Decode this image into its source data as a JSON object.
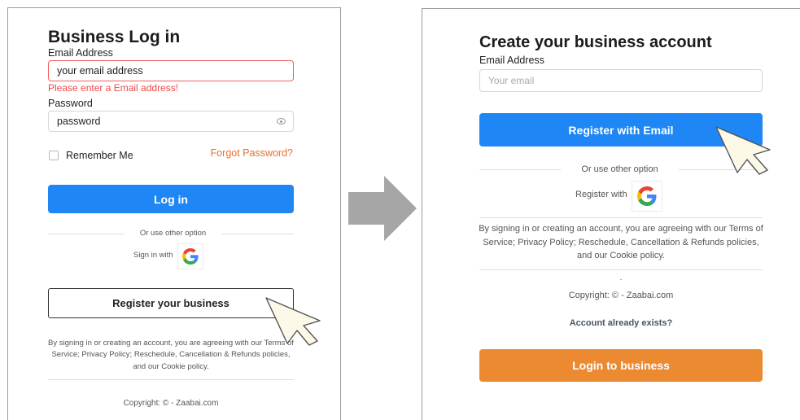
{
  "login": {
    "title": "Business Log in",
    "email_label": "Email Address",
    "email_value": "your email address",
    "email_error": "Please enter a Email address!",
    "password_label": "Password",
    "password_value": "password",
    "remember_label": "Remember Me",
    "forgot_label": "Forgot Password?",
    "login_button": "Log in",
    "divider_text": "Or use other option",
    "social_label": "Sign in with",
    "register_button": "Register your business",
    "legal_lines": [
      "By signing in or creating an account, you are agreeing with our Terms of",
      "Service; Privacy Policy; Reschedule, Cancellation & Refunds policies,",
      "and our Cookie policy."
    ],
    "copyright": "Copyright: © - Zaabai.com"
  },
  "register": {
    "title": "Create your business account",
    "email_label": "Email Address",
    "email_placeholder": "Your email",
    "register_button": "Register with Email",
    "divider_text": "Or use other option",
    "social_label": "Register with",
    "legal_lines": [
      "By signing in or creating an account, you are agreeing with our Terms of",
      "Service; Privacy Policy; Reschedule, Cancellation & Refunds policies,",
      "and our Cookie policy."
    ],
    "dot": ".",
    "copyright": "Copyright: © - Zaabai.com",
    "account_exists": "Account already exists?",
    "login_button": "Login to business"
  },
  "icons": {
    "arrow": "arrow-right-icon",
    "cursor": "pointer-cursor-icon",
    "google": "google-icon",
    "eye": "eye-icon"
  },
  "colors": {
    "primary_blue": "#1e87f5",
    "orange": "#ec8a32",
    "error_red": "#f04848",
    "link_orange": "#e8702a"
  }
}
